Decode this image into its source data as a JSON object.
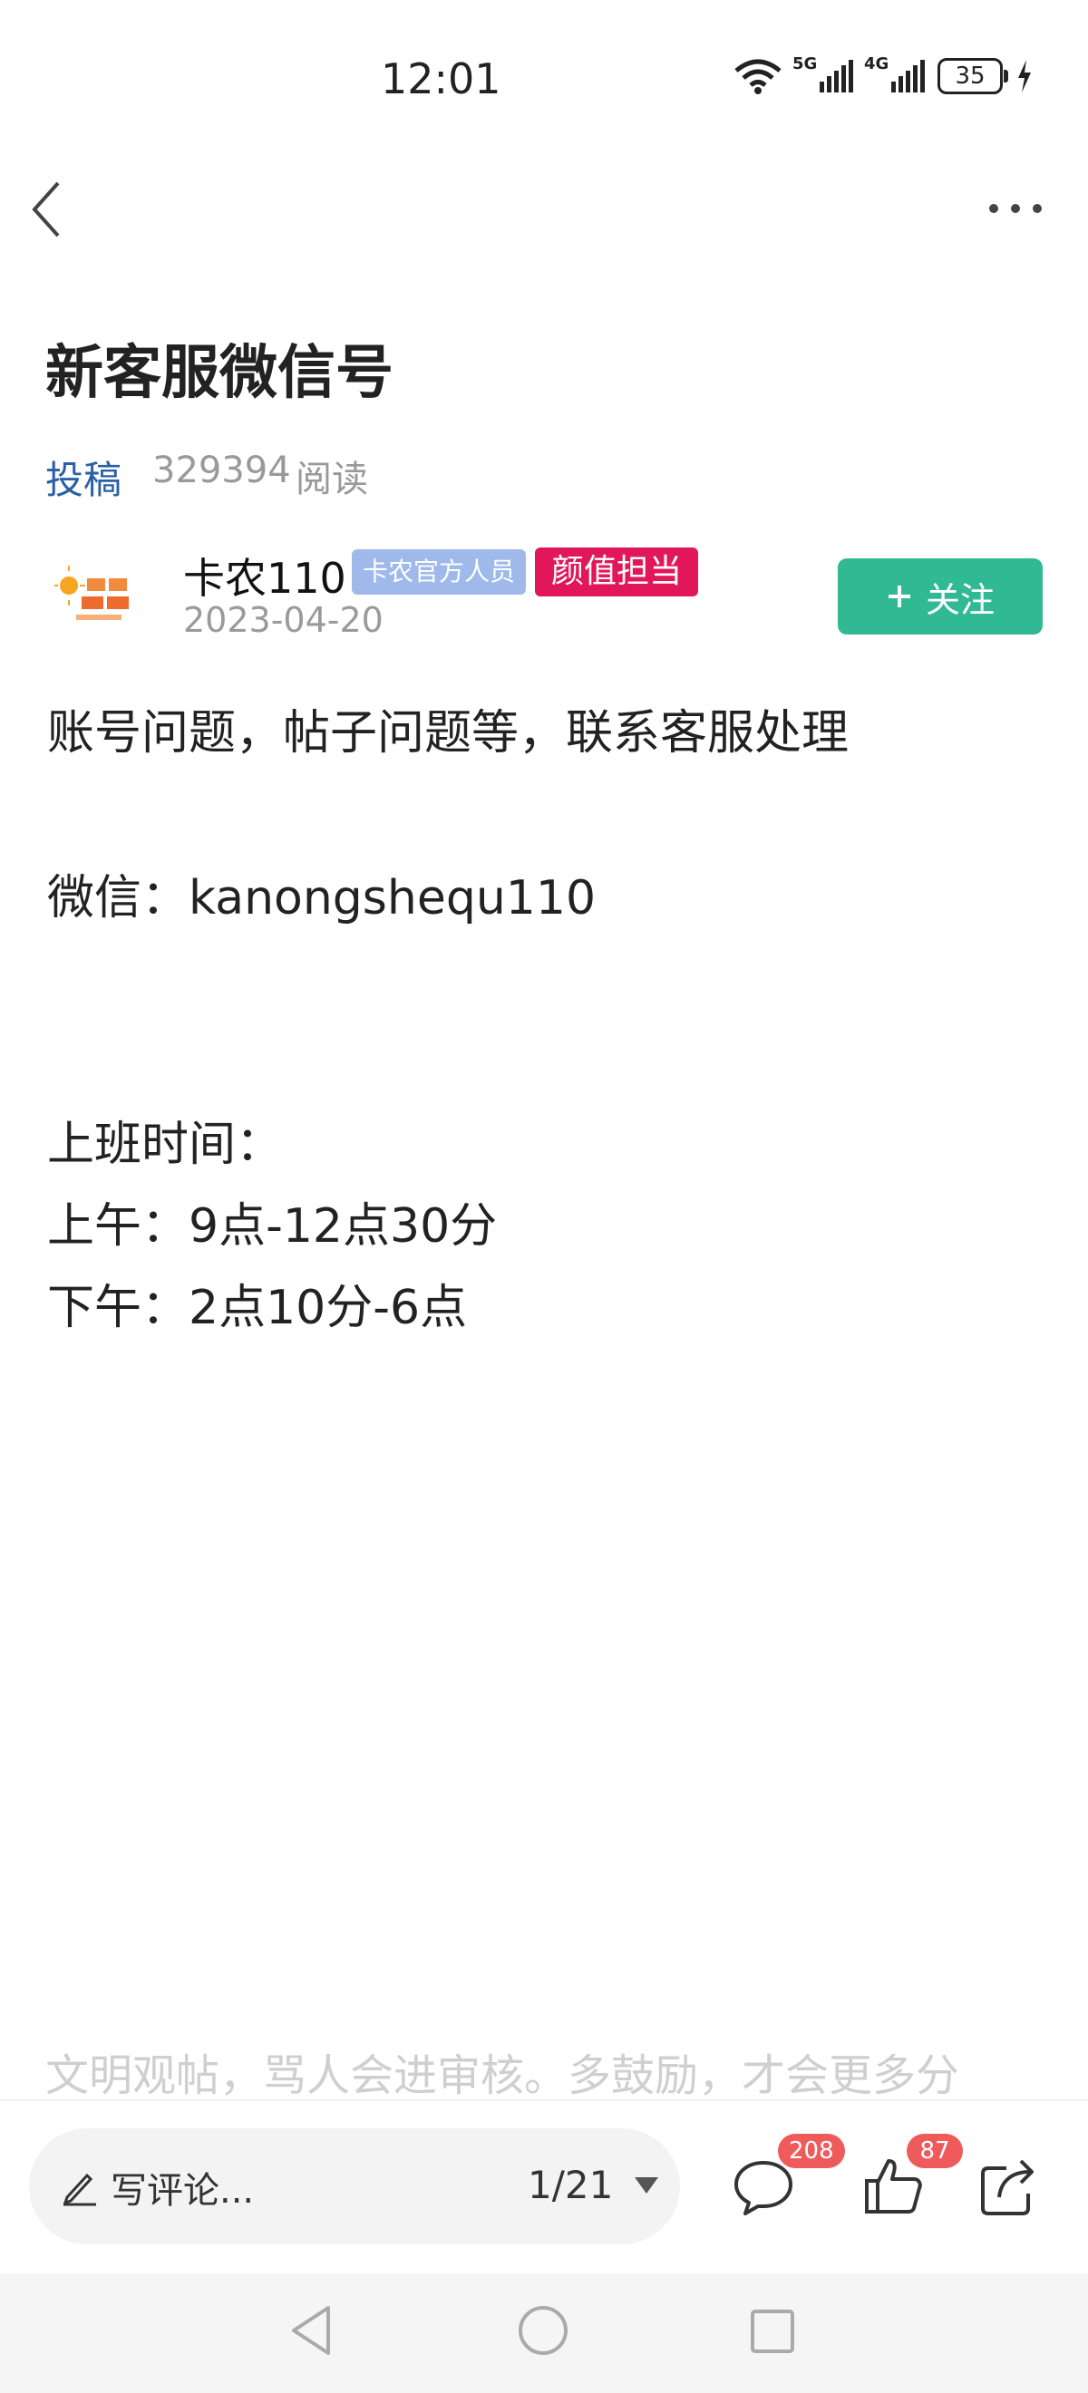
{
  "status_bar": {
    "time": "12:01",
    "battery": "35",
    "net1": "5G",
    "net2": "4G"
  },
  "post": {
    "title": "新客服微信号",
    "category": "投稿",
    "read_count": "329394",
    "read_label": "阅读",
    "author": {
      "name": "卡农110",
      "badge_official": "卡农官方人员",
      "badge_beauty": "颜值担当",
      "date": "2023-04-20"
    },
    "follow_label": "关注",
    "body_lines": [
      "账号问题，帖子问题等，联系客服处理",
      "微信：kanongshequ110",
      "上班时间：",
      "上午：9点-12点30分",
      "下午：2点10分-6点"
    ],
    "notice": "文明观帖，骂人会进审核。多鼓励，才会更多分"
  },
  "bottom_bar": {
    "comment_placeholder": "写评论...",
    "page_indicator": "1/21",
    "comment_count": "208",
    "like_count": "87"
  },
  "colors": {
    "accent": "#31b994",
    "link": "#2b5fa6",
    "badge_official": "#9fb9ea",
    "badge_beauty": "#e1175a",
    "count_badge": "#ef5b5b"
  },
  "icons": [
    "back-icon",
    "more-icon",
    "plus-icon",
    "pencil-icon",
    "caret-down-icon",
    "comment-icon",
    "like-icon",
    "share-icon",
    "nav-back-icon",
    "nav-home-icon",
    "nav-recent-icon"
  ]
}
